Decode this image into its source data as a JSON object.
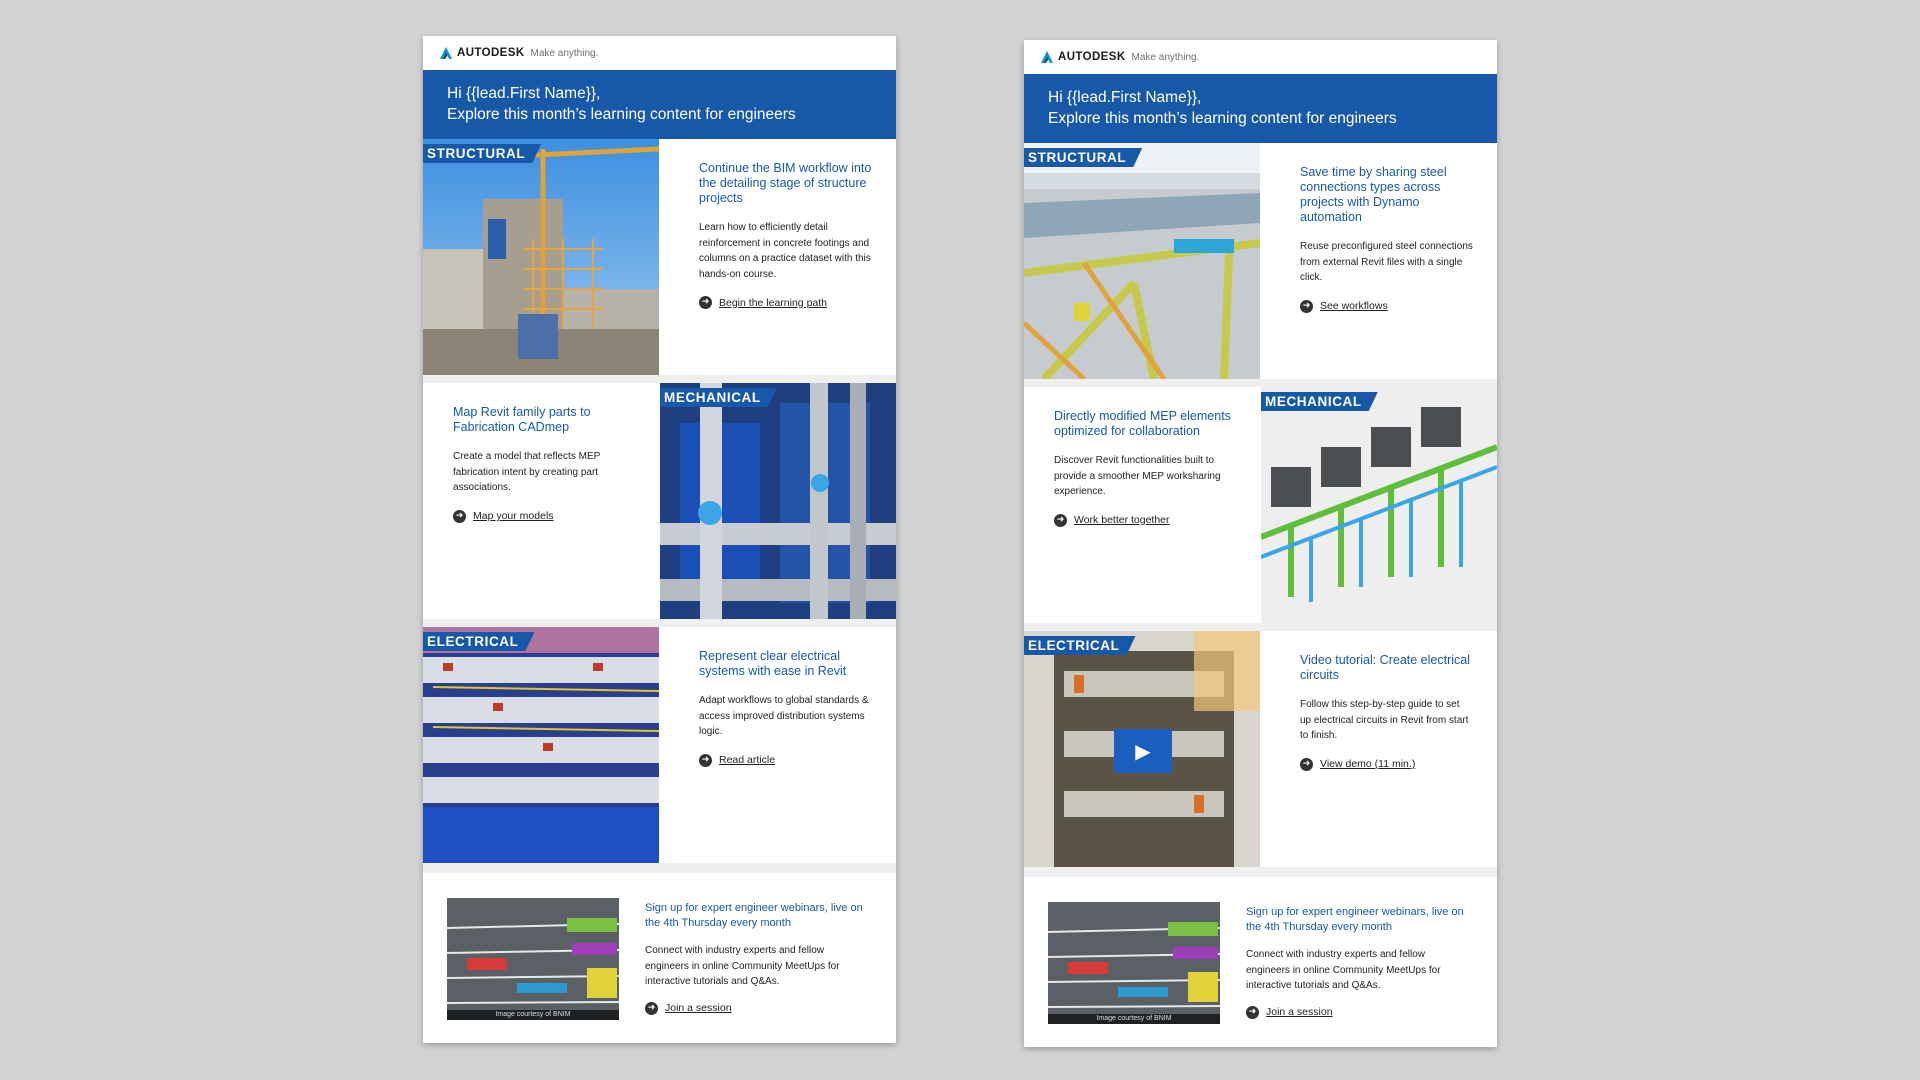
{
  "brand": {
    "name": "AUTODESK",
    "tagline": "Make anything."
  },
  "emails": [
    {
      "greeting": "Hi {{lead.First Name}},",
      "subtitle": "Explore this month’s learning content for engineers",
      "sections": [
        {
          "ribbon": "STRUCTURAL",
          "headline": "Continue the BIM workflow into the detailing stage of structure projects",
          "body": "Learn how to efficiently detail reinforcement in concrete footings and columns on a practice dataset with this hands-on course.",
          "cta": "Begin the learning path"
        },
        {
          "ribbon": "MECHANICAL",
          "headline": "Map Revit family parts to Fabrication CADmep",
          "body": "Create a model that reflects MEP fabrication intent by creating part associations.",
          "cta": "Map your models"
        },
        {
          "ribbon": "ELECTRICAL",
          "headline": "Represent clear electrical systems with ease in Revit",
          "body": "Adapt workflows to global standards & access improved distribution systems logic.",
          "cta": "Read article"
        }
      ],
      "footer": {
        "headline": "Sign up for expert engineer webinars, live on the 4th Thursday every month",
        "body": "Connect with industry experts and fellow engineers in online Community MeetUps for interactive tutorials and Q&As.",
        "cta": "Join a session",
        "caption": "Image courtesy of BNIM"
      }
    },
    {
      "greeting": "Hi {{lead.First Name}},",
      "subtitle": "Explore this month’s learning content for engineers",
      "sections": [
        {
          "ribbon": "STRUCTURAL",
          "headline": "Save time by sharing steel connections types across projects with Dynamo automation",
          "body": "Reuse preconfigured steel connections from external Revit files with a single click.",
          "cta": "See workflows"
        },
        {
          "ribbon": "MECHANICAL",
          "headline": "Directly modified MEP elements optimized for collaboration",
          "body": "Discover Revit functionalities built to provide a smoother MEP worksharing experience.",
          "cta": "Work better together"
        },
        {
          "ribbon": "ELECTRICAL",
          "headline": "Video tutorial: Create electrical circuits",
          "body": "Follow this step-by-step guide to set up electrical circuits in Revit from start to finish.",
          "cta": "View demo (11 min.)"
        }
      ],
      "footer": {
        "headline": "Sign up for expert engineer webinars, live on the 4th Thursday every month",
        "body": "Connect with industry experts and fellow engineers in online Community MeetUps for interactive tutorials and Q&As.",
        "cta": "Join a session",
        "caption": "Image courtesy of BNIM"
      }
    }
  ],
  "colors": {
    "brand_blue": "#1858a8",
    "background": "#d3d3d3",
    "separator": "#efefef"
  }
}
